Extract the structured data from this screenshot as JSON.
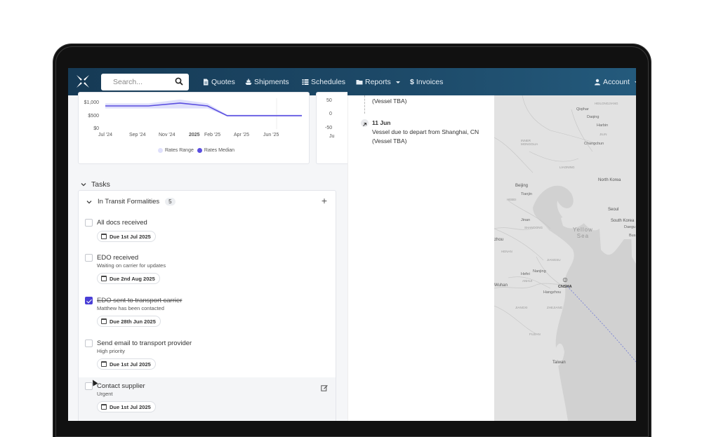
{
  "navbar": {
    "search_placeholder": "Search...",
    "links": {
      "quotes": "Quotes",
      "shipments": "Shipments",
      "schedules": "Schedules",
      "reports": "Reports",
      "invoices": "Invoices",
      "account": "Account"
    },
    "colors": {
      "bar": "#1d4a69"
    }
  },
  "chart_data": {
    "type": "line",
    "x": [
      "Jul '24",
      "Sep '24",
      "Nov '24",
      "2025",
      "Feb '25",
      "Apr '25",
      "Jun '25"
    ],
    "y_ticks": [
      "$1,000",
      "$500",
      "$0"
    ],
    "series": [
      {
        "name": "Rates Range",
        "type": "area",
        "color": "#dfe0fb",
        "low": [
          800,
          800,
          800,
          800,
          500,
          500,
          500,
          500
        ],
        "high": [
          1000,
          1000,
          1150,
          1000,
          560,
          560,
          560,
          560
        ]
      },
      {
        "name": "Rates Median",
        "type": "line",
        "color": "#5a4ee0",
        "values": [
          900,
          900,
          1010,
          900,
          520,
          520,
          520,
          520
        ]
      }
    ],
    "ylim": [
      0,
      1200
    ],
    "legend": "bottom"
  },
  "chart2_ticks": [
    "50",
    "0",
    "-50",
    "Ju"
  ],
  "tasks": {
    "header": "Tasks",
    "group": {
      "label": "In Transit Formalities",
      "count": "5"
    },
    "items": [
      {
        "title": "All docs received",
        "subtitle": "",
        "due": "Due 1st Jul 2025",
        "checked": false
      },
      {
        "title": "EDO received",
        "subtitle": "Waiting on carrier for updates",
        "due": "Due 2nd Aug 2025",
        "checked": false
      },
      {
        "title": "EDO sent to transport carrier",
        "subtitle": "Matthew has been contacted",
        "due": "Due 28th Jun 2025",
        "checked": true
      },
      {
        "title": "Send email to transport provider",
        "subtitle": "High priority",
        "due": "Due 1st Jul 2025",
        "checked": false
      },
      {
        "title": "Contact supplier",
        "subtitle": "Urgent",
        "due": "Due 1st Jul 2025",
        "checked": false
      }
    ]
  },
  "timeline": {
    "prev_vessel": "(Vessel TBA)",
    "date": "11 Jun",
    "event": "Vessel due to depart from Shanghai, CN",
    "vessel": "(Vessel TBA)"
  },
  "map": {
    "labels": {
      "qiqihar": "Qiqihar",
      "daqing": "Daqing",
      "harbin": "Harbin",
      "heilongjiang": "HEILONGJIANG",
      "inner_mongolia": "INNER\nMONGOLIA",
      "jilin": "JILIN",
      "changchun": "Changchun",
      "liaoning": "LIAONING",
      "beijing": "Beijing",
      "tianjin": "Tianjin",
      "hebei": "HEBEI",
      "north_korea": "North Korea",
      "seoul": "Seoul",
      "south_korea": "South Korea",
      "daegu": "Daegu",
      "busan": "Bus",
      "jinan": "Jinan",
      "shandong": "SHANDONG",
      "yellow_sea": "Yellow\nSea",
      "zhou": "zhou",
      "henan": "HENAN",
      "jiangsu": "JIANGSU",
      "hefei": "Hefei",
      "nanjing": "Nanjing",
      "anhui": "ANHUI",
      "wuhan": "Wuhan",
      "cnsha": "CNSHA",
      "hangzhou": "Hangzhou",
      "zhejiang": "ZHEJIANG",
      "jiangxi": "JIANGXI",
      "fujian": "FUJIAN",
      "taiwan": "Taiwan"
    }
  }
}
